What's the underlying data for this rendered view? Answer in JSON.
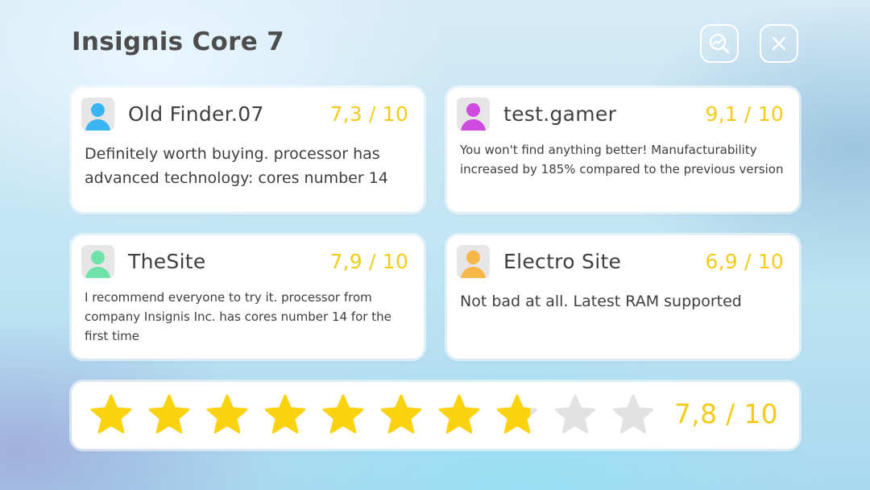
{
  "header": {
    "title": "Insignis Core 7",
    "analyze_icon": "magnifier-chart-icon",
    "close_icon": "close-icon"
  },
  "reviews": [
    {
      "name": "Old Finder.07",
      "score": "7,3 / 10",
      "text": "Definitely worth buying. processor has advanced technology: cores number 14",
      "avatar_color": "#3ab4f2",
      "icon": "user-avatar-icon"
    },
    {
      "name": "test.gamer",
      "score": "9,1 / 10",
      "text": "You won't find anything better! Manufacturability increased by 185% compared to the previous version",
      "avatar_color": "#d04ce0",
      "icon": "user-avatar-icon"
    },
    {
      "name": "TheSite",
      "score": "7,9 / 10",
      "text": "I recommend everyone to try it. processor from company Insignis Inc. has cores number 14 for the first time",
      "avatar_color": "#6fe2a8",
      "icon": "user-avatar-icon"
    },
    {
      "name": "Electro Site",
      "score": "6,9 / 10",
      "text": "Not bad at all. Latest RAM supported",
      "avatar_color": "#f7b645",
      "icon": "user-avatar-icon"
    }
  ],
  "overall": {
    "score_label": "7,8 / 10",
    "rating": 7.8,
    "max": 10,
    "star_filled_color": "#fbd20e",
    "star_empty_color": "#e2e2e2"
  },
  "colors": {
    "score_text": "#f3cc1b",
    "title_text": "#4d4d4d"
  }
}
